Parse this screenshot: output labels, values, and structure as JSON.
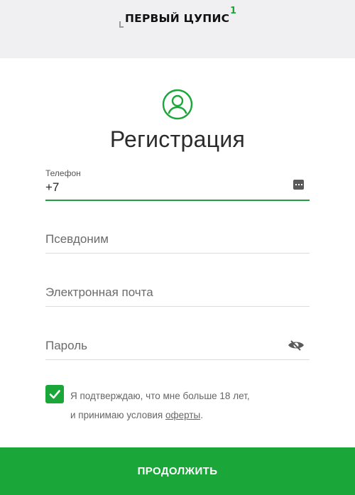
{
  "header": {
    "logo_text": "ПЕРВЫЙ ЦУПИС",
    "logo_mark": "1",
    "background_color": "#f0f0f2"
  },
  "form": {
    "avatar_icon": "user-circle-icon",
    "title": "Регистрация",
    "phone": {
      "label": "Телефон",
      "value": "+7",
      "trailing_icon": "keyboard-dots-icon"
    },
    "nickname": {
      "placeholder": "Псевдоним"
    },
    "email": {
      "placeholder": "Электронная почта"
    },
    "password": {
      "placeholder": "Пароль",
      "trailing_icon": "eye-hidden-icon"
    },
    "consent": {
      "checked": true,
      "line1": "Я подтверждаю, что мне больше 18 лет,",
      "line2_prefix": "и принимаю условия ",
      "link": "оферты",
      "line2_suffix": "."
    },
    "continue_label": "ПРОДОЛЖИТЬ"
  },
  "colors": {
    "accent": "#1aa638",
    "focus_underline": "#1e9e40",
    "divider": "#dcdcdc"
  }
}
